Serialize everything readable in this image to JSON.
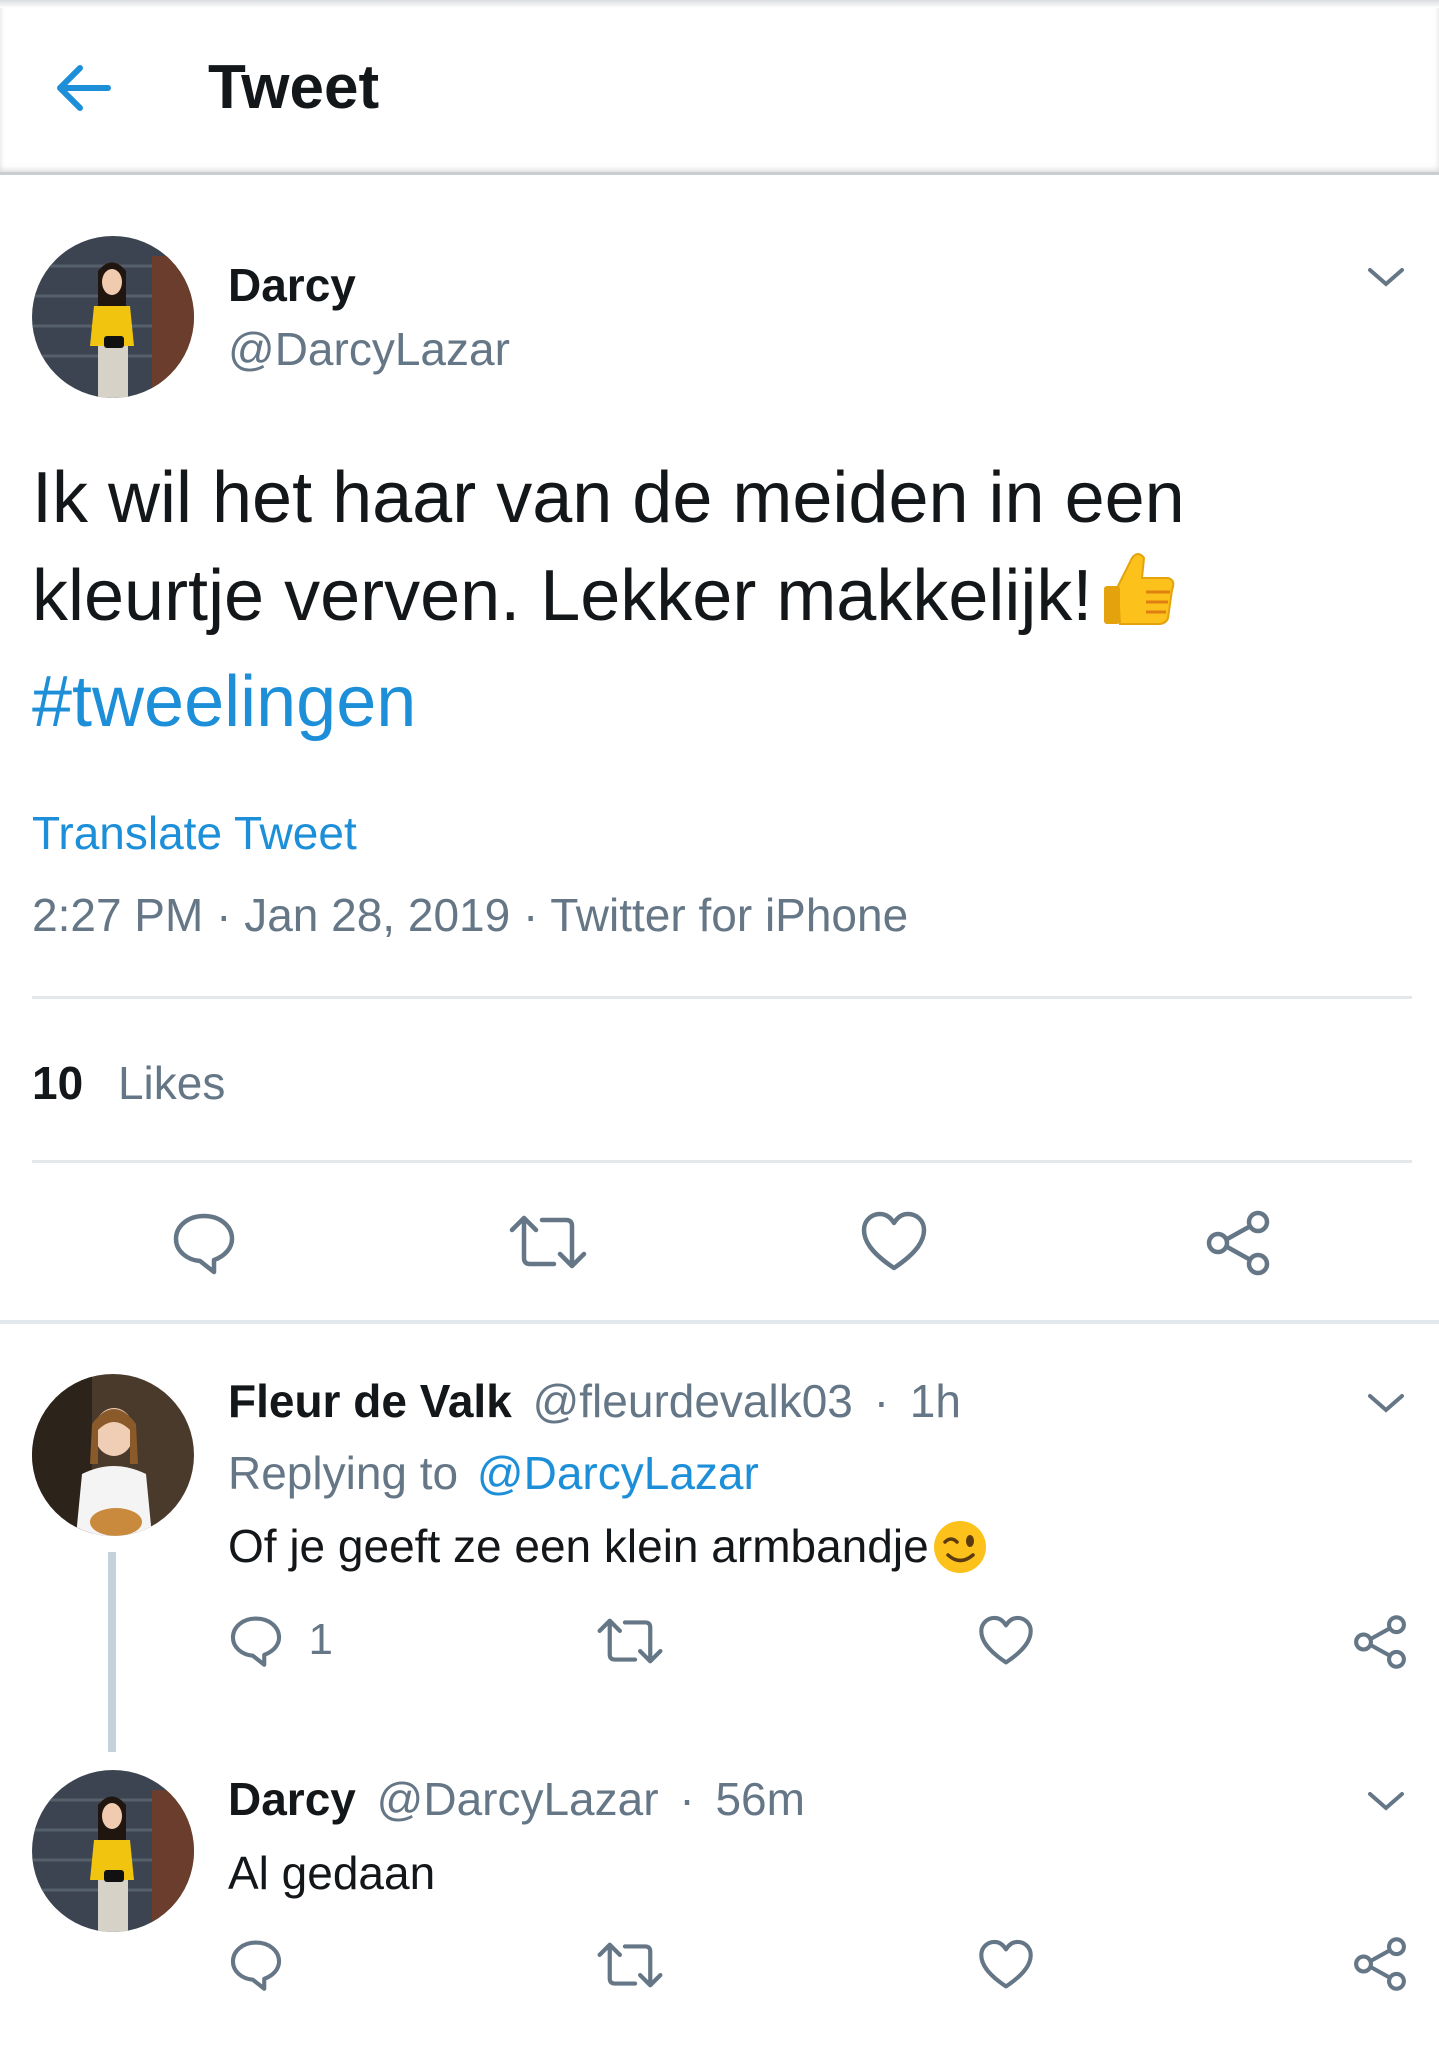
{
  "header": {
    "title": "Tweet"
  },
  "tweet": {
    "name": "Darcy",
    "handle": "@DarcyLazar",
    "text_line1": "Ik wil het haar van de meiden in een",
    "text_line2": "kleurtje verven. Lekker makkelijk!",
    "hashtag": "#tweelingen",
    "translate": "Translate Tweet",
    "meta": "2:27 PM · Jan 28, 2019 · Twitter for iPhone",
    "likes_count": "10",
    "likes_label": "Likes"
  },
  "replies": [
    {
      "name": "Fleur de Valk",
      "handle": "@fleurdevalk03",
      "sep": "·",
      "time": "1h",
      "replying_prefix": "Replying to",
      "replying_to": "@DarcyLazar",
      "text": "Of je geeft ze een klein armbandje",
      "reply_count": "1"
    },
    {
      "name": "Darcy",
      "handle": "@DarcyLazar",
      "sep": "·",
      "time": "56m",
      "text": "Al gedaan"
    }
  ],
  "icons": [
    "back-arrow-icon",
    "chevron-down-icon",
    "reply-icon",
    "retweet-icon",
    "like-icon",
    "share-icon",
    "thumbs-up-emoji",
    "wink-emoji"
  ],
  "colors": {
    "link": "#1d8fd9",
    "muted": "#657786",
    "text": "#14171a",
    "divider": "#e3e8ec",
    "thread_line": "#c6d2db"
  }
}
